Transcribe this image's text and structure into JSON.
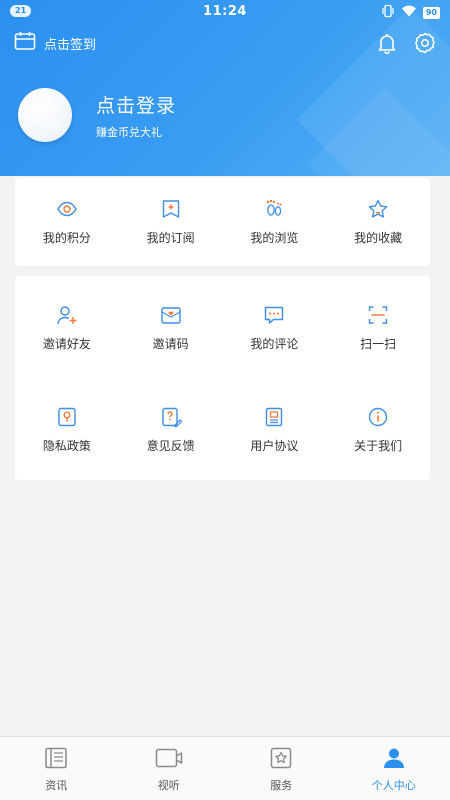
{
  "status_bar": {
    "notification_count": "21",
    "time": "11:24",
    "battery": "90"
  },
  "header": {
    "checkin_label": "点击签到",
    "login_title": "点击登录",
    "login_subtitle": "赚金币兑大礼"
  },
  "quick_links": [
    {
      "label": "我的积分",
      "icon": "eye-icon"
    },
    {
      "label": "我的订阅",
      "icon": "bookmark-plus-icon"
    },
    {
      "label": "我的浏览",
      "icon": "footprints-icon"
    },
    {
      "label": "我的收藏",
      "icon": "star-icon"
    }
  ],
  "services": [
    {
      "label": "邀请好友",
      "icon": "add-user-icon"
    },
    {
      "label": "邀请码",
      "icon": "mail-heart-icon"
    },
    {
      "label": "我的评论",
      "icon": "comment-icon"
    },
    {
      "label": "扫一扫",
      "icon": "scan-icon"
    },
    {
      "label": "隐私政策",
      "icon": "privacy-icon"
    },
    {
      "label": "意见反馈",
      "icon": "feedback-icon"
    },
    {
      "label": "用户协议",
      "icon": "agreement-icon"
    },
    {
      "label": "关于我们",
      "icon": "info-icon"
    }
  ],
  "tabs": [
    {
      "label": "资讯",
      "icon": "news-icon",
      "active": false
    },
    {
      "label": "视听",
      "icon": "video-icon",
      "active": false
    },
    {
      "label": "服务",
      "icon": "service-icon",
      "active": false
    },
    {
      "label": "个人中心",
      "icon": "person-icon",
      "active": true
    }
  ],
  "colors": {
    "accent": "#2b8ff0",
    "icon_blue": "#3d8fe8",
    "icon_orange": "#f07a3a",
    "text": "#333333"
  }
}
